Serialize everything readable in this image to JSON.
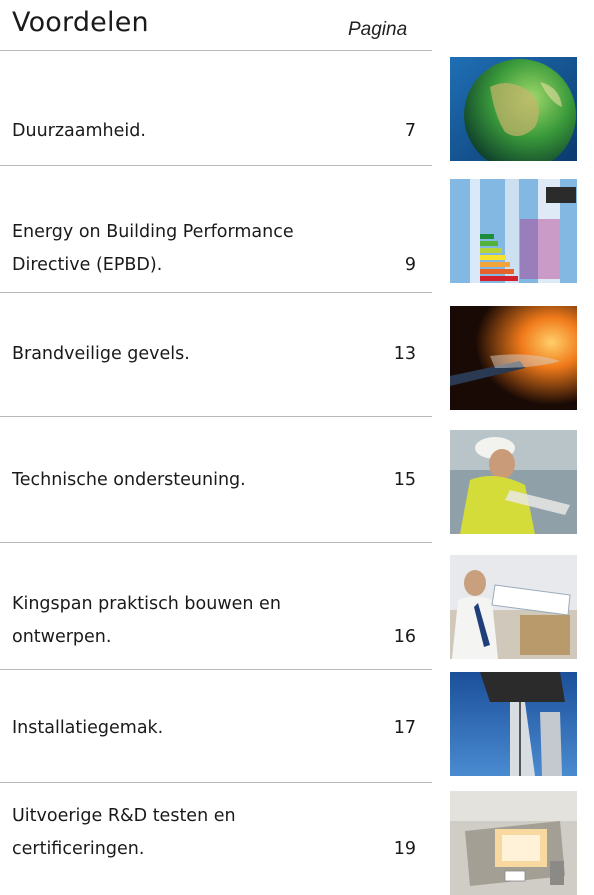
{
  "header": {
    "title": "Voordelen",
    "pagina_label": "Pagina"
  },
  "entries": [
    {
      "lines": [
        "Duurzaamheid."
      ],
      "page": "7",
      "image": "globe-photo"
    },
    {
      "lines": [
        "Energy on Building Performance",
        "Directive (EPBD)."
      ],
      "page": "9",
      "image": "energy-label-photo"
    },
    {
      "lines": [
        "Brandveilige gevels."
      ],
      "page": "13",
      "image": "fire-test-photo"
    },
    {
      "lines": [
        "Technische ondersteuning."
      ],
      "page": "15",
      "image": "engineer-hardhat-photo"
    },
    {
      "lines": [
        "Kingspan praktisch bouwen en",
        "ontwerpen."
      ],
      "page": "16",
      "image": "architect-plans-photo"
    },
    {
      "lines": [
        "Installatiegemak."
      ],
      "page": "17",
      "image": "crane-installation-photo"
    },
    {
      "lines": [
        "Uitvoerige R&D testen en",
        "certificeringen."
      ],
      "page": "19",
      "image": "test-facility-photo"
    }
  ]
}
